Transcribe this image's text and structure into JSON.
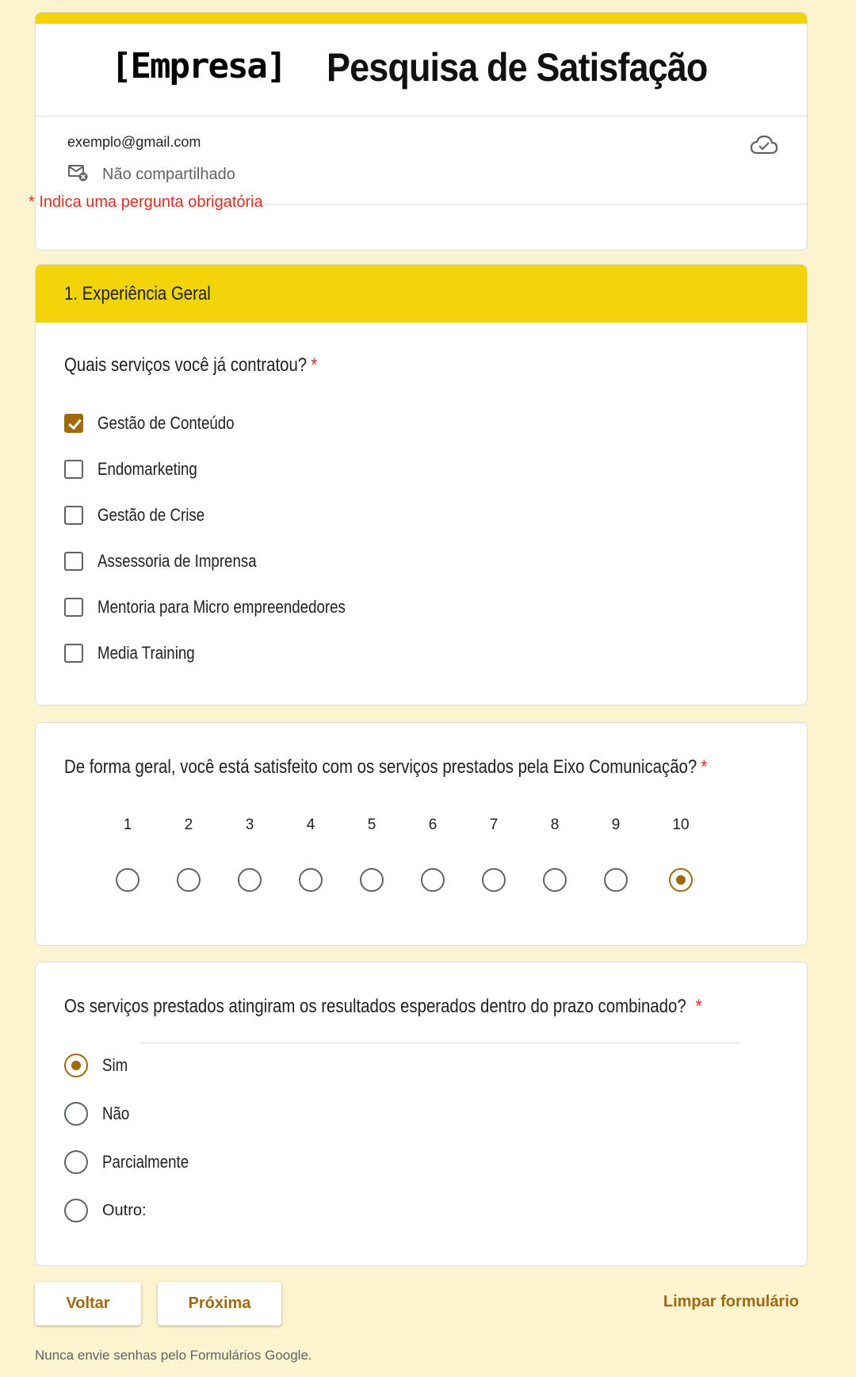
{
  "header": {
    "company": "[Empresa]",
    "title": "Pesquisa de Satisfação",
    "email": "exemplo@gmail.com",
    "not_shared": "Não compartilhado",
    "required_note": "* Indica uma pergunta obrigatória"
  },
  "section": {
    "title": "1. Experiência Geral"
  },
  "q1": {
    "title": "Quais serviços você já contratou?",
    "required_mark": "*",
    "options": [
      {
        "label": "Gestão de Conteúdo",
        "checked": true
      },
      {
        "label": "Endomarketing",
        "checked": false
      },
      {
        "label": "Gestão de Crise",
        "checked": false
      },
      {
        "label": "Assessoria de Imprensa",
        "checked": false
      },
      {
        "label": "Mentoria para Micro empreendedores",
        "checked": false
      },
      {
        "label": "Media Training",
        "checked": false
      }
    ]
  },
  "q2": {
    "title": "De forma geral, você está satisfeito com os serviços prestados pela Eixo Comunicação?",
    "required_mark": "*",
    "scale": [
      "1",
      "2",
      "3",
      "4",
      "5",
      "6",
      "7",
      "8",
      "9",
      "10"
    ],
    "selected": "10"
  },
  "q3": {
    "title": "Os serviços prestados atingiram os resultados esperados dentro do prazo combinado?",
    "required_mark": "*",
    "options": [
      "Sim",
      "Não",
      "Parcialmente",
      "Outro:"
    ],
    "selected": "Sim",
    "other_value": ""
  },
  "nav": {
    "back_label": "Voltar",
    "next_label": "Próxima",
    "clear_label": "Limpar formulário"
  },
  "footer": {
    "note": "Nunca envie senhas pelo Formulários Google."
  },
  "colors": {
    "accent": "#a0690e",
    "banner": "#f2d40a",
    "background": "#fcf3cf",
    "required": "#d93025"
  }
}
